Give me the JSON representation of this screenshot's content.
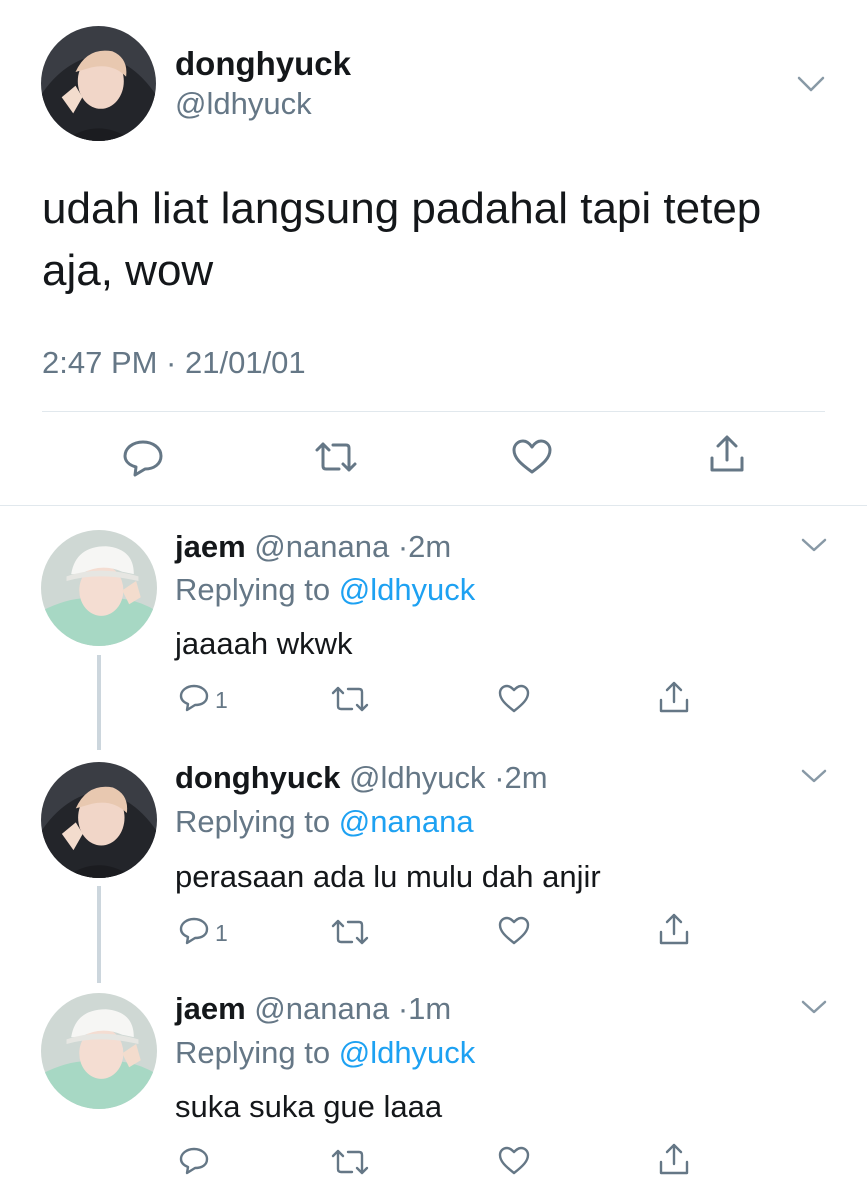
{
  "main_tweet": {
    "display_name": "donghyuck",
    "handle": "@ldhyuck",
    "text": "udah liat langsung padahal tapi tetep aja, wow",
    "timestamp": "2:47 PM · 21/01/01",
    "actions": [
      "reply-icon",
      "retweet-icon",
      "like-icon",
      "share-icon"
    ]
  },
  "replies": [
    {
      "display_name": "jaem",
      "handle": "@nanana",
      "dot": "·",
      "time": "2m",
      "replying_prefix": "Replying to ",
      "replying_to": "@ldhyuck",
      "text": "jaaaah wkwk",
      "reply_count": "1"
    },
    {
      "display_name": "donghyuck",
      "handle": "@ldhyuck",
      "dot": "·",
      "time": "2m",
      "replying_prefix": "Replying to ",
      "replying_to": "@nanana",
      "text": "perasaan ada lu mulu dah anjir",
      "reply_count": "1"
    },
    {
      "display_name": "jaem",
      "handle": "@nanana",
      "dot": "·",
      "time": "1m",
      "replying_prefix": "Replying to ",
      "replying_to": "@ldhyuck",
      "text": "suka suka gue laaa",
      "reply_count": ""
    }
  ],
  "colors": {
    "text": "#14171a",
    "secondary": "#657786",
    "link": "#1da1f2",
    "divider": "#e1e8ed",
    "thread_line": "#ccd6dd"
  }
}
